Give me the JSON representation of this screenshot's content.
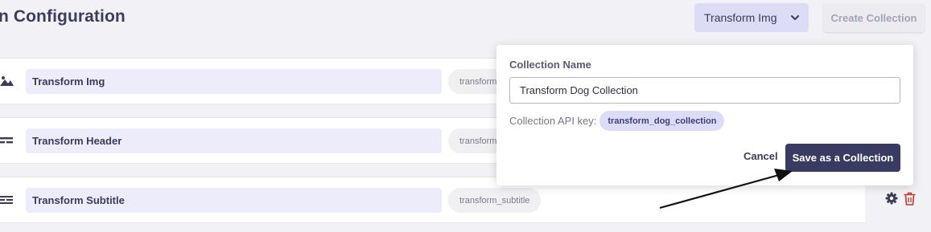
{
  "header": {
    "title": "n Configuration",
    "dropdown_value": "Transform Img",
    "create_button": "Create Collection"
  },
  "fields": [
    {
      "name": "Transform Img",
      "key": "transform",
      "icon": "image-icon"
    },
    {
      "name": "Transform Header",
      "key": "transform",
      "icon": "header-field-icon"
    },
    {
      "name": "Transform Subtitle",
      "key": "transform_subtitle",
      "icon": "subtitle-field-icon"
    }
  ],
  "popover": {
    "name_label": "Collection Name",
    "name_value": "Transform Dog Collection",
    "api_key_label": "Collection API key:",
    "api_key_value": "transform_dog_collection",
    "cancel_label": "Cancel",
    "save_label": "Save as a Collection"
  },
  "icons": [
    "chevron-down-icon",
    "image-icon",
    "header-field-icon",
    "subtitle-field-icon",
    "gear-icon",
    "trash-icon"
  ],
  "colors": {
    "primary": "#3a3b63",
    "accent_light": "#dcdcf7",
    "field_bg": "#ececfa",
    "danger": "#c0392b"
  }
}
